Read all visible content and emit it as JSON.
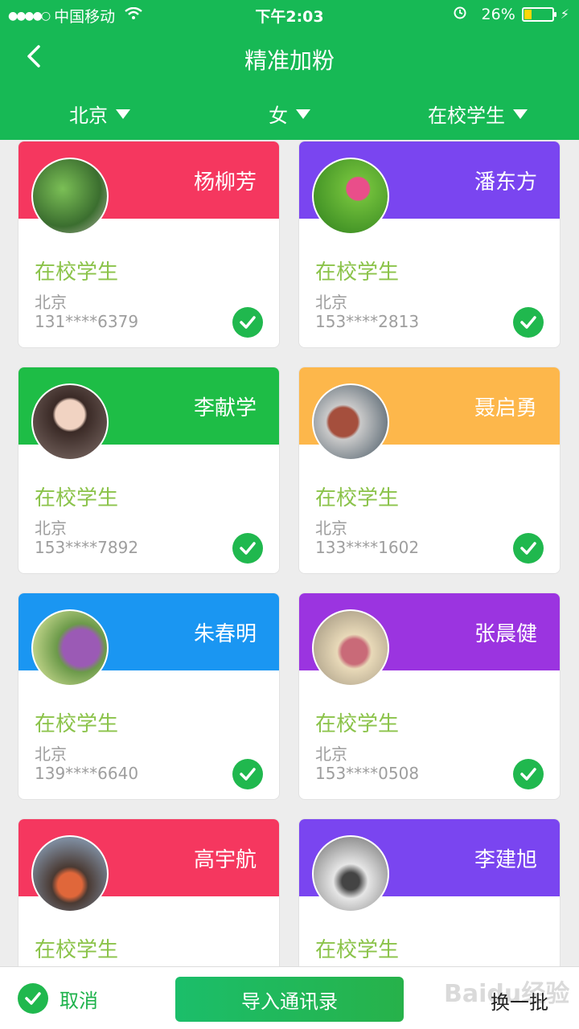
{
  "status": {
    "carrier": "中国移动",
    "time": "下午2:03",
    "battery": "26%",
    "icons": [
      "signal-dots-icon",
      "wifi-icon",
      "alarm-icon",
      "battery-icon",
      "charging-bolt-icon"
    ]
  },
  "nav": {
    "title": "精准加粉",
    "back_icon": "chevron-left-icon"
  },
  "filters": {
    "city": "北京",
    "gender": "女",
    "status": "在校学生"
  },
  "cards": [
    {
      "name": "杨柳芳",
      "role": "在校学生",
      "city": "北京",
      "phone": "131****6379",
      "color": "#f5375f"
    },
    {
      "name": "潘东方",
      "role": "在校学生",
      "city": "北京",
      "phone": "153****2813",
      "color": "#7a45f0"
    },
    {
      "name": "李献学",
      "role": "在校学生",
      "city": "北京",
      "phone": "153****7892",
      "color": "#1ebd46"
    },
    {
      "name": "聂启勇",
      "role": "在校学生",
      "city": "北京",
      "phone": "133****1602",
      "color": "#fdb74b"
    },
    {
      "name": "朱春明",
      "role": "在校学生",
      "city": "北京",
      "phone": "139****6640",
      "color": "#1a96f2"
    },
    {
      "name": "张晨健",
      "role": "在校学生",
      "city": "北京",
      "phone": "153****0508",
      "color": "#9b34e0"
    },
    {
      "name": "高宇航",
      "role": "在校学生",
      "city": "",
      "phone": "",
      "color": "#f5375f"
    },
    {
      "name": "李建旭",
      "role": "在校学生",
      "city": "",
      "phone": "",
      "color": "#7a45f0"
    }
  ],
  "bottom": {
    "cancel_label": "取消",
    "import_label": "导入通讯录",
    "batch_label": "换一批",
    "watermark": "Baidu经验"
  },
  "colors": {
    "primary": "#17b955",
    "role_text": "#8bc34a",
    "check": "#20b84e"
  }
}
